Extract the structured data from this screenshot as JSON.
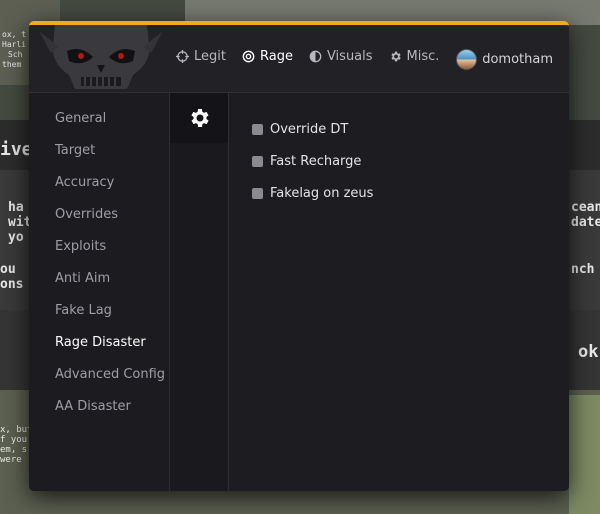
{
  "nav": {
    "tabs": [
      {
        "label": "Legit",
        "icon": "crosshair-icon"
      },
      {
        "label": "Rage",
        "icon": "target-icon"
      },
      {
        "label": "Visuals",
        "icon": "half-circle-icon"
      },
      {
        "label": "Misc.",
        "icon": "gear-icon"
      }
    ],
    "active": "Rage"
  },
  "user": {
    "name": "domotham"
  },
  "sidebar": {
    "items": [
      {
        "label": "General"
      },
      {
        "label": "Target"
      },
      {
        "label": "Accuracy"
      },
      {
        "label": "Overrides"
      },
      {
        "label": "Exploits"
      },
      {
        "label": "Anti Aim"
      },
      {
        "label": "Fake Lag"
      },
      {
        "label": "Rage Disaster"
      },
      {
        "label": "Advanced Config"
      },
      {
        "label": "AA Disaster"
      }
    ],
    "active": "Rage Disaster"
  },
  "subtabs": [
    {
      "icon": "gear-icon"
    }
  ],
  "options": [
    {
      "label": "Override DT",
      "checked": false
    },
    {
      "label": "Fast Recharge",
      "checked": false
    },
    {
      "label": "Fakelag on zeus",
      "checked": false
    }
  ],
  "colors": {
    "accent": "#f5a623",
    "window": "#1c1c20",
    "checkbox": "#8a8a90"
  },
  "background_text": {
    "top_left": [
      "ox, t",
      "Harli",
      "Sch",
      "them"
    ],
    "left_middle": [
      "ive",
      "ha",
      "with",
      "yo",
      "ou",
      "ons"
    ],
    "left_bottom": [
      "x, but",
      "f you",
      "em, s",
      "were"
    ],
    "right_middle": [
      "cean",
      "date",
      "nch",
      "ok"
    ]
  }
}
